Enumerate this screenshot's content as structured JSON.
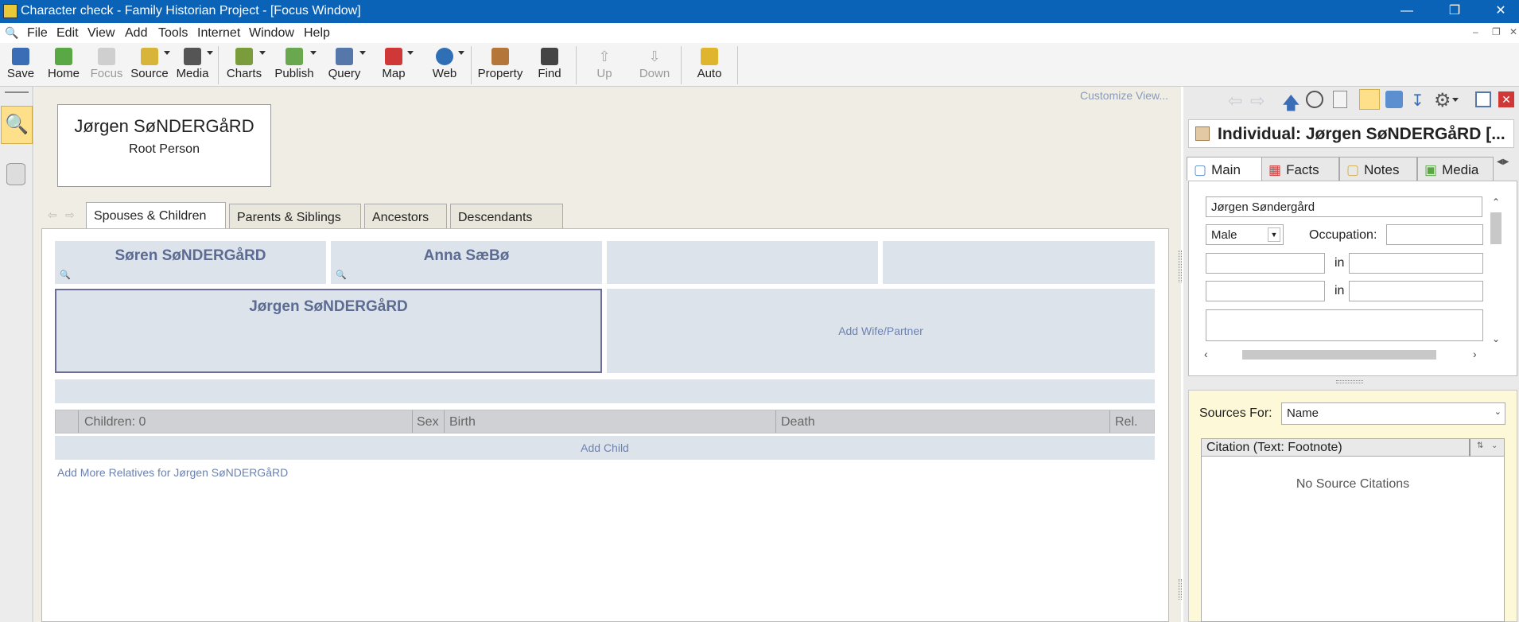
{
  "window": {
    "title": "Character check - Family Historian Project - [Focus Window]"
  },
  "menu": [
    "File",
    "Edit",
    "View",
    "Add",
    "Tools",
    "Internet",
    "Window",
    "Help"
  ],
  "toolbar": {
    "save": "Save",
    "home": "Home",
    "focus": "Focus",
    "source": "Source",
    "media": "Media",
    "charts": "Charts",
    "publish": "Publish",
    "query": "Query",
    "map": "Map",
    "web": "Web",
    "property": "Property",
    "find": "Find",
    "up": "Up",
    "down": "Down",
    "auto": "Auto"
  },
  "customize": "Customize View...",
  "root": {
    "name": "Jørgen SøNDERGåRD",
    "label": "Root Person"
  },
  "tabs": [
    "Spouses & Children",
    "Parents & Siblings",
    "Ancestors",
    "Descendants"
  ],
  "parents": {
    "father": "Søren SøNDERGåRD",
    "mother": "Anna SæBø"
  },
  "focus_person": "Jørgen SøNDERGåRD",
  "add_partner": "Add Wife/Partner",
  "children_table": {
    "headers": [
      "Children: 0",
      "Sex",
      "Birth",
      "Death",
      "Rel."
    ]
  },
  "add_child": "Add Child",
  "add_more": "Add More Relatives for Jørgen SøNDERGåRD",
  "property": {
    "title": "Individual: Jørgen SøNDERGåRD [...",
    "tabs": [
      "Main",
      "Facts",
      "Notes",
      "Media"
    ],
    "name": "Jørgen Søndergård",
    "sex": "Male",
    "occupation_label": "Occupation:",
    "in1": "in",
    "in2": "in",
    "sources_for_label": "Sources For:",
    "sources_for_value": "Name",
    "citation_header": "Citation (Text: Footnote)",
    "no_citations": "No Source Citations"
  },
  "colors": {
    "titlebar": "#0b63b8",
    "person_box": "#dde3ea",
    "person_text": "#5b6b92"
  }
}
